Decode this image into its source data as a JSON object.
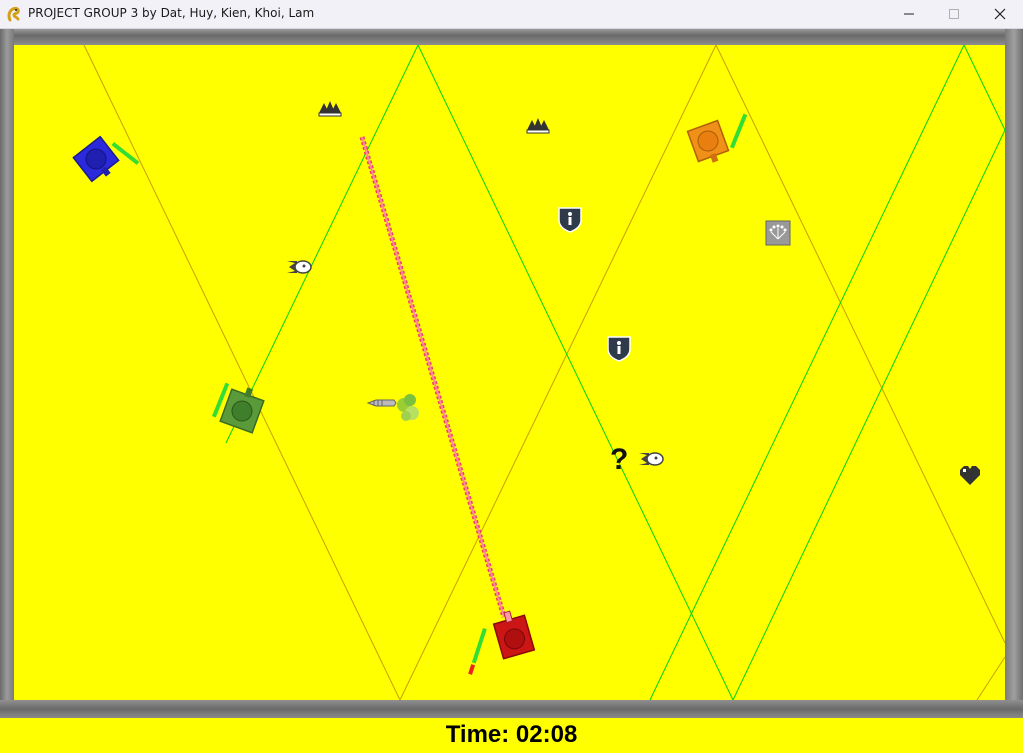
{
  "window": {
    "title": "PROJECT GROUP 3 by Dat, Huy, Kien, Khoi, Lam",
    "icon": "pygame-snake-icon",
    "controls": [
      "minimize",
      "maximize",
      "close"
    ]
  },
  "arena": {
    "background_color": "#ffff00",
    "line_colors": {
      "green": "#00d400",
      "brown": "#c8a000"
    }
  },
  "tanks": [
    {
      "name": "blue-tank",
      "color": "#2a2adc",
      "health_bar_color": "#33dd33"
    },
    {
      "name": "orange-tank",
      "color": "#f09018",
      "health_bar_color": "#33dd33"
    },
    {
      "name": "green-tank",
      "color": "#5a9a3a",
      "health_bar_color": "#33dd33"
    },
    {
      "name": "red-tank",
      "color": "#cc1515",
      "health_bar_color": "#33dd33",
      "damage_color": "#ee2222"
    }
  ],
  "powerups": [
    {
      "name": "triple-shot-icon"
    },
    {
      "name": "triple-shot-icon"
    },
    {
      "name": "shield-icon"
    },
    {
      "name": "shield-icon"
    },
    {
      "name": "speed-bullet-icon"
    },
    {
      "name": "speed-bullet-icon"
    },
    {
      "name": "scatter-shot-icon"
    },
    {
      "name": "heart-icon"
    },
    {
      "name": "mystery-question-icon",
      "text": "?"
    }
  ],
  "effects": {
    "laser_color": "#f04060",
    "missile": "missile-icon"
  },
  "hud": {
    "timer_label": "Time: 02:08"
  }
}
